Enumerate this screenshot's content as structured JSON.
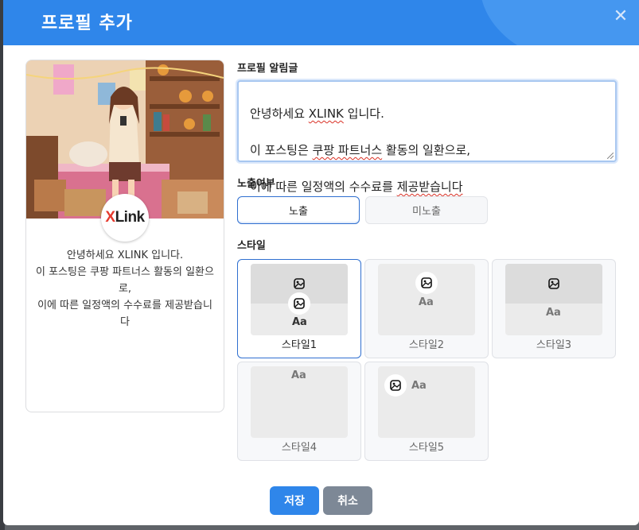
{
  "modal": {
    "title": "프로필 추가",
    "close_icon": "close-icon"
  },
  "preview": {
    "logo_x": "X",
    "logo_rest": "Link",
    "text": "안녕하세요 XLINK 입니다.\n이 포스팅은 쿠팡 파트너스 활동의 일환으로,\n이에 따른 일정액의 수수료를 제공받습니다"
  },
  "form": {
    "message_label": "프로필 알림글",
    "message_lines": [
      {
        "before": "안녕하세요 ",
        "squiggle": "XLINK",
        "after": " 입니다."
      },
      {
        "before": "이 포스팅은 ",
        "squiggle": "쿠팡 파트너스",
        "after": " 활동의 일환으로,"
      },
      {
        "before": "이에 따른 일정액의 수수료를 ",
        "squiggle": "제공받습니다",
        "after": ""
      }
    ],
    "visibility_label": "노출여부",
    "visibility_on": "노출",
    "visibility_off": "미노출",
    "style_label": "스타일",
    "styles": [
      {
        "name": "스타일1",
        "aa": "Aa"
      },
      {
        "name": "스타일2",
        "aa": "Aa"
      },
      {
        "name": "스타일3",
        "aa": "Aa"
      },
      {
        "name": "스타일4",
        "aa": "Aa"
      },
      {
        "name": "스타일5",
        "aa": "Aa"
      }
    ],
    "selected_style": "스타일1"
  },
  "buttons": {
    "save": "저장",
    "cancel": "취소"
  },
  "colors": {
    "accent": "#2f86ea",
    "cancel": "#7d8896"
  }
}
